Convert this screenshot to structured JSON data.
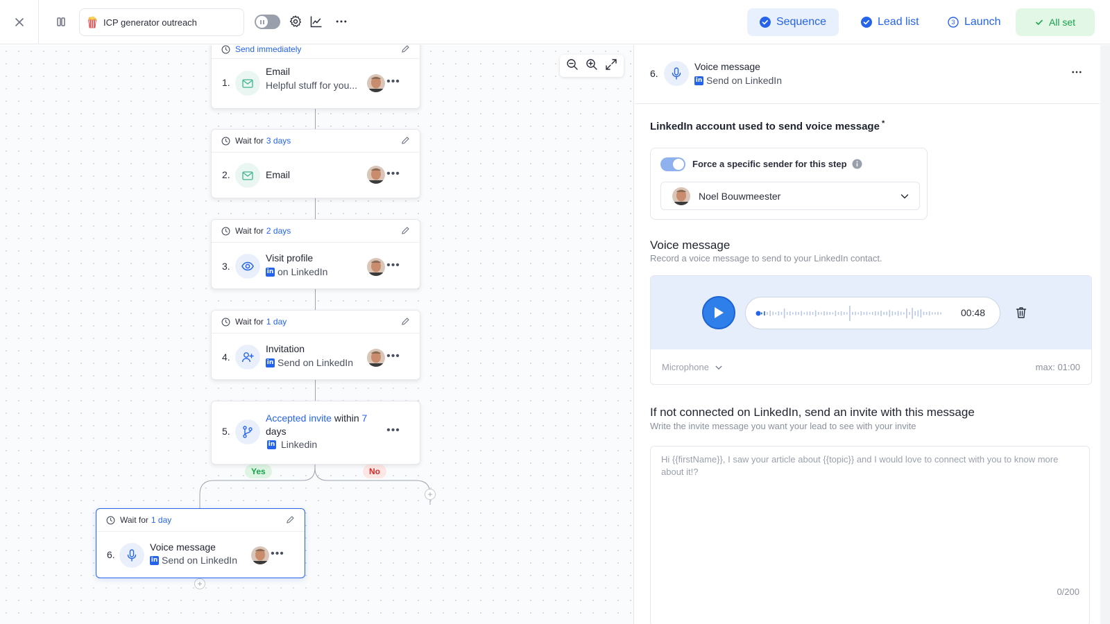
{
  "topbar": {
    "campaign_name": "ICP generator outreach",
    "tabs": {
      "sequence": "Sequence",
      "lead_list": "Lead list",
      "launch": "Launch",
      "all_set": "All set"
    }
  },
  "sequence": {
    "steps": [
      {
        "num": "1.",
        "header": "Send immediately",
        "title": "Email",
        "subtitle": "Helpful stuff for you..."
      },
      {
        "num": "2.",
        "header_prefix": "Wait for",
        "header_value": "3 days",
        "title": "Email"
      },
      {
        "num": "3.",
        "header_prefix": "Wait for",
        "header_value": "2 days",
        "title": "Visit profile",
        "subtitle": "on LinkedIn"
      },
      {
        "num": "4.",
        "header_prefix": "Wait for",
        "header_value": "1 day",
        "title": "Invitation",
        "subtitle": "Send on LinkedIn"
      },
      {
        "num": "5.",
        "title_link": "Accepted invite",
        "title_mid": "within",
        "title_value": "7",
        "title_end": "days",
        "subtitle": "Linkedin"
      },
      {
        "num": "6.",
        "header_prefix": "Wait for",
        "header_value": "1 day",
        "title": "Voice message",
        "subtitle": "Send on LinkedIn"
      }
    ],
    "branch_yes": "Yes",
    "branch_no": "No"
  },
  "panel": {
    "step_num": "6.",
    "step_title": "Voice message",
    "step_sub": "Send on LinkedIn",
    "account_heading": "LinkedIn account used to send voice message",
    "required_mark": "*",
    "force_label": "Force a specific sender for this step",
    "sender_name": "Noel Bouwmeester",
    "voice_heading": "Voice message",
    "voice_sub": "Record a voice message to send to your LinkedIn contact.",
    "duration": "00:48",
    "mic_label": "Microphone",
    "max_label": "max: 01:00",
    "invite_heading": "If not connected on LinkedIn, send an invite with this message",
    "invite_sub": "Write the invite message you want your lead to see with your invite",
    "invite_text": "Hi {{firstName}}, I saw your article about {{topic}} and I would love to connect with you to know more about it!?",
    "char_count": "0/200"
  },
  "colors": {
    "accent": "#2563eb",
    "success": "#16a34a",
    "danger": "#dc2626"
  }
}
